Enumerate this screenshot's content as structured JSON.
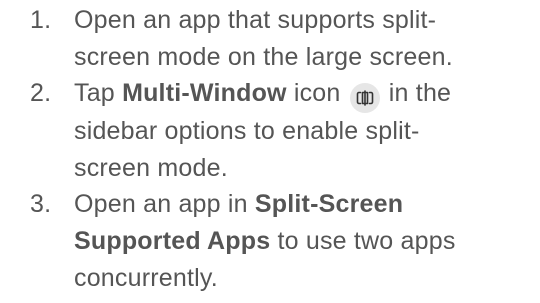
{
  "steps": [
    {
      "number": "1.",
      "lines": [
        "Open an app that supports split-",
        "screen mode on the large screen."
      ]
    },
    {
      "number": "2.",
      "text_1": "Tap ",
      "bold_1": "Multi-Window",
      "text_2": " icon ",
      "icon": "multi-window-icon",
      "text_3": " in the",
      "line_2": "sidebar options to enable split-",
      "line_3": "screen mode."
    },
    {
      "number": "3.",
      "text_1": "Open an app in ",
      "bold_1": "Split-Screen",
      "bold_2": "Supported Apps",
      "text_2": " to use two apps",
      "line_3": "concurrently."
    }
  ]
}
